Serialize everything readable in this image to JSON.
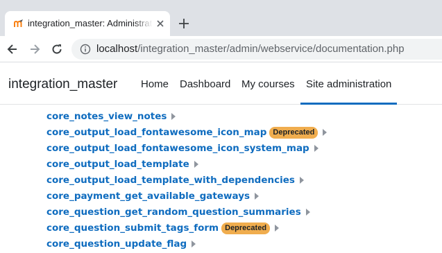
{
  "browser": {
    "tab_title": "integration_master: Administration",
    "url_host": "localhost",
    "url_path": "/integration_master/admin/webservice/documentation.php"
  },
  "navbar": {
    "brand": "integration_master",
    "links": [
      "Home",
      "Dashboard",
      "My courses",
      "Site administration"
    ],
    "active": "Site administration"
  },
  "functions": [
    {
      "name": "core_notes_view_notes",
      "deprecated": false
    },
    {
      "name": "core_output_load_fontawesome_icon_map",
      "deprecated": true
    },
    {
      "name": "core_output_load_fontawesome_icon_system_map",
      "deprecated": false
    },
    {
      "name": "core_output_load_template",
      "deprecated": false
    },
    {
      "name": "core_output_load_template_with_dependencies",
      "deprecated": false
    },
    {
      "name": "core_payment_get_available_gateways",
      "deprecated": false
    },
    {
      "name": "core_question_get_random_question_summaries",
      "deprecated": false
    },
    {
      "name": "core_question_submit_tags_form",
      "deprecated": true
    },
    {
      "name": "core_question_update_flag",
      "deprecated": false
    }
  ],
  "badge_label": "Deprecated",
  "colors": {
    "link": "#0f6cbf",
    "badge": "#f0ad4e",
    "active_underline": "#0f6cbf"
  }
}
